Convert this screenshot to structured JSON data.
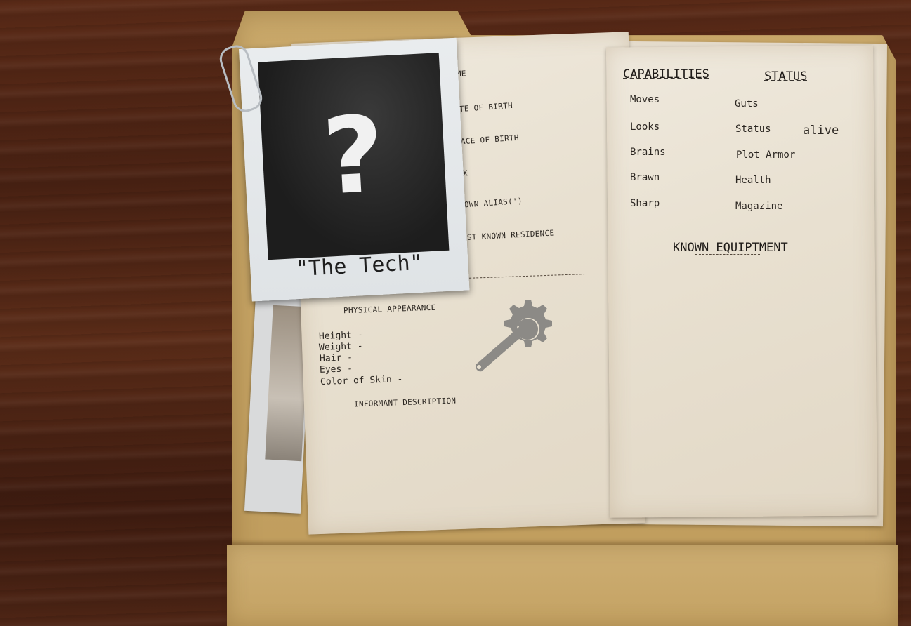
{
  "dossier": {
    "photo_caption": "\"The Tech\"",
    "photo_placeholder": "?",
    "identity_fields": [
      "NAME",
      "DATE OF BIRTH",
      "PLACE OF BIRTH",
      "SEX",
      "KNOWN ALIAS(')",
      "LAST KNOWN RESIDENCE"
    ],
    "physical_heading": "PHYSICAL APPEARANCE",
    "physical_fields": [
      "Height -",
      "Weight -",
      "Hair -",
      "Eyes -",
      "Color of Skin -"
    ],
    "informant_heading": "INFORMANT DESCRIPTION",
    "emblem": "wrench-gear-icon"
  },
  "capabilities": {
    "heading": "CAPABILITIES",
    "items": [
      "Moves",
      "Looks",
      "Brains",
      "Brawn",
      "Sharp"
    ]
  },
  "status": {
    "heading": "STATUS",
    "items": [
      {
        "label": "Guts",
        "value": ""
      },
      {
        "label": "Status",
        "value": "alive"
      },
      {
        "label": "Plot Armor",
        "value": ""
      },
      {
        "label": "Health",
        "value": ""
      },
      {
        "label": "Magazine",
        "value": ""
      }
    ]
  },
  "equipment": {
    "heading": "KNOWN EQUIPTMENT"
  }
}
